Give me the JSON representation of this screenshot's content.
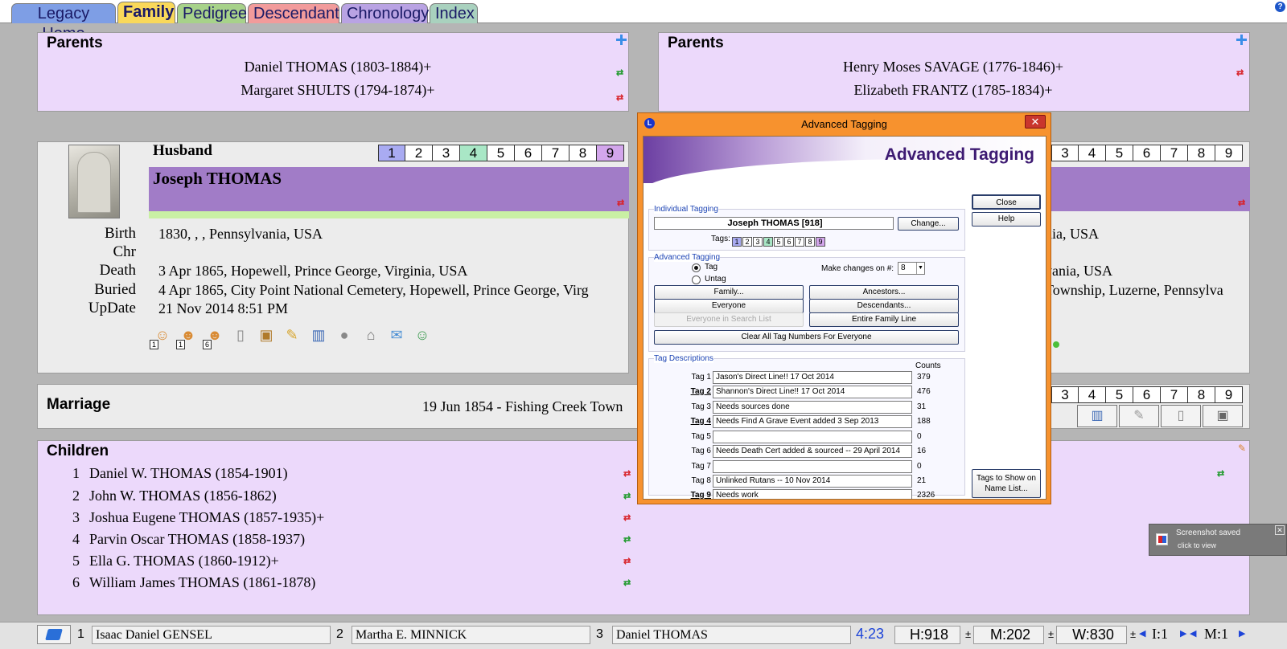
{
  "tabs": [
    "Legacy Home",
    "Family",
    "Pedigree",
    "Descendant",
    "Chronology",
    "Index"
  ],
  "tab_colors": [
    "#7e9ee5",
    "#f9d85a",
    "#a7d28a",
    "#f29b9b",
    "#b9a3e3",
    "#a9d1be"
  ],
  "left_parents": {
    "title": "Parents",
    "father": "Daniel THOMAS (1803-1884)+",
    "mother": "Margaret SHULTS (1794-1874)+"
  },
  "right_parents": {
    "title": "Parents",
    "father": "Henry Moses SAVAGE (1776-1846)+",
    "mother": "Elizabeth FRANTZ (1785-1834)+"
  },
  "husband": {
    "label": "Husband",
    "name": "Joseph THOMAS",
    "tags": [
      "1",
      "2",
      "3",
      "4",
      "5",
      "6",
      "7",
      "8",
      "9"
    ],
    "events": [
      {
        "label": "Birth",
        "value": "1830, , , Pennsylvania, USA"
      },
      {
        "label": "Chr",
        "value": ""
      },
      {
        "label": "Death",
        "value": "3 Apr 1865, Hopewell, Prince George, Virginia, USA"
      },
      {
        "label": "Buried",
        "value": "4 Apr 1865, City Point National Cemetery, Hopewell, Prince George, Virg"
      },
      {
        "label": "UpDate",
        "value": "21 Nov 2014 8:51 PM"
      }
    ],
    "tool_icons": [
      "person-icon",
      "parents-icon",
      "family-icon",
      "notes-icon",
      "picture-icon",
      "sources-icon",
      "books-icon",
      "group-icon",
      "home-icon",
      "map-icon",
      "user-check-icon"
    ],
    "tool_badges": [
      "1",
      "1",
      "6"
    ]
  },
  "wife": {
    "tags": [
      "3",
      "4",
      "5",
      "6",
      "7",
      "8",
      "9"
    ],
    "events_partial": [
      "nia, USA",
      "",
      "vania, USA",
      "Township, Luzerne, Pennsylva"
    ]
  },
  "marriage": {
    "title": "Marriage",
    "value": "19 Jun 1854 - Fishing Creek Town",
    "tags": [
      "3",
      "4",
      "5",
      "6",
      "7",
      "8",
      "9"
    ]
  },
  "children": {
    "title": "Children",
    "items": [
      {
        "num": "1",
        "name": "Daniel W. THOMAS (1854-1901)"
      },
      {
        "num": "2",
        "name": "John W. THOMAS (1856-1862)"
      },
      {
        "num": "3",
        "name": "Joshua Eugene THOMAS (1857-1935)+"
      },
      {
        "num": "4",
        "name": "Parvin Oscar THOMAS (1858-1937)"
      },
      {
        "num": "5",
        "name": "Ella G. THOMAS (1860-1912)+"
      },
      {
        "num": "6",
        "name": "William James THOMAS (1861-1878)"
      }
    ]
  },
  "dialog": {
    "title": "Advanced Tagging",
    "banner": "Advanced Tagging",
    "close": "Close",
    "help": "Help",
    "individual_group": "Individual Tagging",
    "person": "Joseph THOMAS [918]",
    "change": "Change...",
    "tags_label": "Tags:",
    "tags": [
      "1",
      "2",
      "3",
      "4",
      "5",
      "6",
      "7",
      "8",
      "9"
    ],
    "advanced_group": "Advanced Tagging",
    "tag_radio": "Tag",
    "untag_radio": "Untag",
    "make_changes_label": "Make changes on #:",
    "make_changes_value": "8",
    "buttons": {
      "family": "Family...",
      "ancestors": "Ancestors...",
      "everyone": "Everyone",
      "descendants": "Descendants...",
      "search_list": "Everyone in Search List",
      "family_line": "Entire Family Line",
      "clear_all": "Clear All Tag Numbers For Everyone"
    },
    "descriptions_group": "Tag Descriptions",
    "counts_label": "Counts",
    "tag_rows": [
      {
        "label": "Tag 1",
        "desc": "Jason's Direct Line!! 17 Oct 2014",
        "count": "379"
      },
      {
        "label": "Tag 2",
        "desc": "Shannon's Direct Line!! 17 Oct 2014",
        "count": "476"
      },
      {
        "label": "Tag 3",
        "desc": "Needs sources done",
        "count": "31"
      },
      {
        "label": "Tag 4",
        "desc": "Needs Find A Grave Event added 3 Sep 2013",
        "count": "188"
      },
      {
        "label": "Tag 5",
        "desc": "",
        "count": "0"
      },
      {
        "label": "Tag 6",
        "desc": "Needs Death Cert added & sourced -- 29 April 2014",
        "count": "16"
      },
      {
        "label": "Tag 7",
        "desc": "",
        "count": "0"
      },
      {
        "label": "Tag 8",
        "desc": "Unlinked Rutans -- 10 Nov 2014",
        "count": "21"
      },
      {
        "label": "Tag 9",
        "desc": "Needs work",
        "count": "2326"
      }
    ],
    "show_on_name_list": "Tags to Show on Name List..."
  },
  "toast": {
    "title": "Screenshot saved",
    "subtitle": "click to view"
  },
  "status": {
    "s1_num": "1",
    "s1_name": "Isaac Daniel GENSEL",
    "s2_num": "2",
    "s2_name": "Martha E. MINNICK",
    "s3_num": "3",
    "s3_name": "Daniel THOMAS",
    "time": "4:23",
    "h": "H:918",
    "m": "M:202",
    "w": "W:830",
    "i": "I:1",
    "m2": "M:1"
  }
}
